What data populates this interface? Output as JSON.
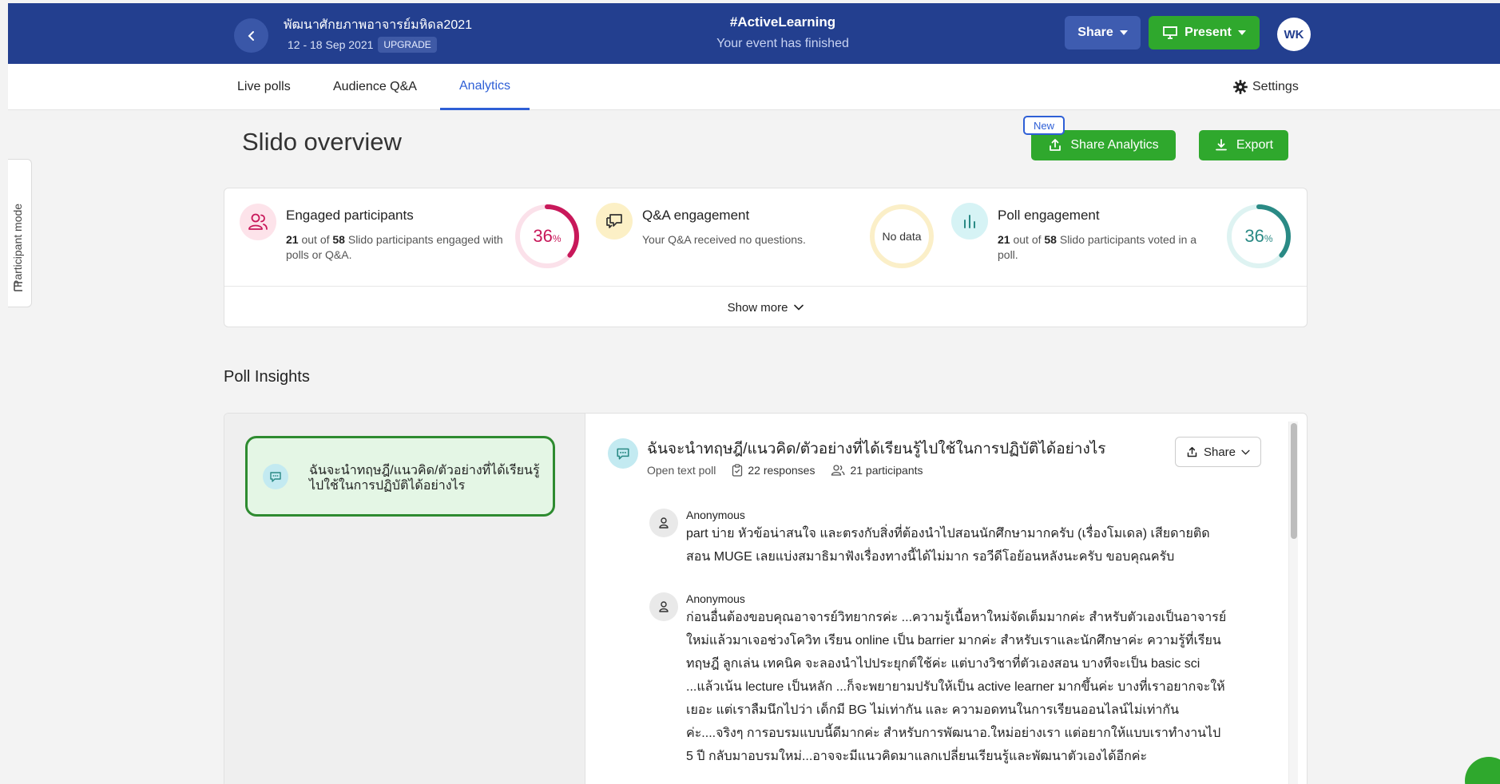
{
  "header": {
    "event_title": "พัฒนาศักยภาพอาจารย์มหิดล2021",
    "event_dates": "12 - 18 Sep 2021",
    "upgrade_label": "UPGRADE",
    "center_title": "#ActiveLearning",
    "center_subtitle": "Your event has finished",
    "share_label": "Share",
    "present_label": "Present",
    "avatar_initials": "WK",
    "brand_color": "#233f8f",
    "accent_green": "#2fa82d"
  },
  "tabs": {
    "live_polls": "Live polls",
    "audience_qa": "Audience Q&A",
    "analytics": "Analytics",
    "settings": "Settings"
  },
  "side": {
    "participant_mode": "Participant mode"
  },
  "overview": {
    "title": "Slido overview",
    "new_badge": "New",
    "share_analytics_label": "Share Analytics",
    "export_label": "Export"
  },
  "stats": {
    "engaged": {
      "title": "Engaged participants",
      "count": "21",
      "desc_1": "out of",
      "total": "58",
      "desc_2": "Slido participants engaged with polls or Q&A.",
      "percent_value": "36",
      "percent_sign": "%",
      "percent_fraction": 0.36,
      "color": "#c8185a"
    },
    "qa": {
      "title": "Q&A engagement",
      "desc": "Your Q&A received no questions.",
      "ring_label": "No data",
      "color": "#f3d57a"
    },
    "poll": {
      "title": "Poll engagement",
      "count": "21",
      "desc_1": "out of",
      "total": "58",
      "desc_2": "Slido participants voted in a poll.",
      "percent_value": "36",
      "percent_sign": "%",
      "percent_fraction": 0.36,
      "color": "#2a8a85"
    },
    "show_more": "Show more"
  },
  "poll_insights": {
    "title": "Poll Insights",
    "selected_poll_text": "ฉันจะนำทฤษฎี/แนวคิด/ตัวอย่างที่ได้เรียนรู้ไปใช้ในการปฏิบัติได้อย่างไร",
    "question": "ฉันจะนำทฤษฎี/แนวคิด/ตัวอย่างที่ได้เรียนรู้ไปใช้ในการปฏิบัติได้อย่างไร",
    "poll_type": "Open text poll",
    "responses": "22 responses",
    "participants": "21 participants",
    "share_label": "Share",
    "responses_list": [
      {
        "name": "Anonymous",
        "text": "part บ่าย หัวข้อน่าสนใจ และตรงกับสิ่งที่ต้องนำไปสอนนักศึกษามากครับ (เรื่องโมเดล) เสียดายติดสอน MUGE เลยแบ่งสมาธิมาฟังเรื่องทางนี้ได้ไม่มาก รอวีดีโอย้อนหลังนะครับ ขอบคุณครับ"
      },
      {
        "name": "Anonymous",
        "text": "ก่อนอื่นต้องขอบคุณอาจารย์วิทยากรค่ะ ...ความรู้เนื้อหาใหม่จัดเต็มมากค่ะ สำหรับตัวเองเป็นอาจารย์ใหม่แล้วมาเจอช่วงโควิท เรียน online เป็น barrier มากค่ะ สำหรับเราและนักศึกษาค่ะ ความรู้ที่เรียนทฤษฎี ลูกเล่น เทคนิค จะลองนำไปประยุกต์ใช้ค่ะ แต่บางวิชาที่ตัวเองสอน บางทีจะเป็น basic sci ...แล้วเน้น lecture เป็นหลัก ...ก็จะพยายามปรับให้เป็น active learner มากขึ้นค่ะ บางที่เราอยากจะให้เยอะ แต่เราลืมนึกไปว่า เด็กมี BG ไม่เท่ากัน และ ความอดทนในการเรียนออนไลน์ไม่เท่ากันค่ะ....จริงๆ การอบรมแบบนี้ดีมากค่ะ สำหรับการพัฒนาอ.ใหม่อย่างเรา แต่อยากให้แบบเราทำงานไป 5 ปี กลับมาอบรมใหม่...อาจจะมีแนวคิดมาแลกเปลี่ยนเรียนรู้และพัฒนาตัวเองได้อีกค่ะ"
      }
    ]
  }
}
